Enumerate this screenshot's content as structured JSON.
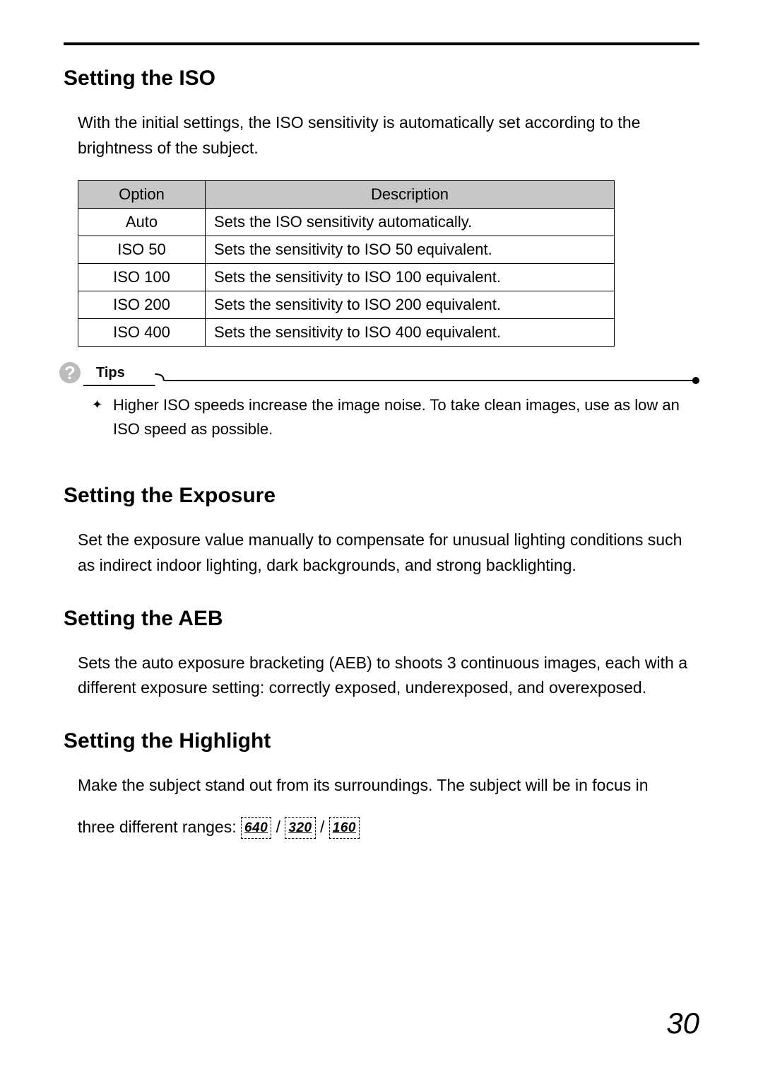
{
  "sections": {
    "iso": {
      "heading": "Setting the ISO",
      "intro": "With the initial settings, the ISO sensitivity is automatically set according to the brightness of the subject.",
      "table": {
        "headers": {
          "option": "Option",
          "description": "Description"
        },
        "rows": [
          {
            "option": "Auto",
            "description": "Sets the ISO sensitivity automatically."
          },
          {
            "option": "ISO 50",
            "description": "Sets the sensitivity to ISO 50 equivalent."
          },
          {
            "option": "ISO 100",
            "description": "Sets the sensitivity to ISO 100 equivalent."
          },
          {
            "option": "ISO 200",
            "description": "Sets the sensitivity to ISO 200 equivalent."
          },
          {
            "option": "ISO 400",
            "description": "Sets the sensitivity to ISO 400 equivalent."
          }
        ]
      },
      "tips_label": "Tips",
      "tips_bullet": "Higher ISO speeds increase the image noise. To take clean images, use as low an ISO speed as possible."
    },
    "exposure": {
      "heading": "Setting the Exposure",
      "body": "Set the exposure value manually to compensate for unusual lighting conditions such as indirect indoor lighting, dark backgrounds, and strong backlighting."
    },
    "aeb": {
      "heading": "Setting the AEB",
      "body": "Sets the auto exposure bracketing (AEB) to shoots 3 continuous images, each with a different exposure setting: correctly exposed, underexposed, and overexposed."
    },
    "highlight": {
      "heading": "Setting the Highlight",
      "line1": "Make the subject stand out from its surroundings. The subject will be in focus in",
      "line2_prefix": "three different ranges: ",
      "ranges": [
        "640",
        "320",
        "160"
      ],
      "sep": " / "
    }
  },
  "page_number": "30"
}
